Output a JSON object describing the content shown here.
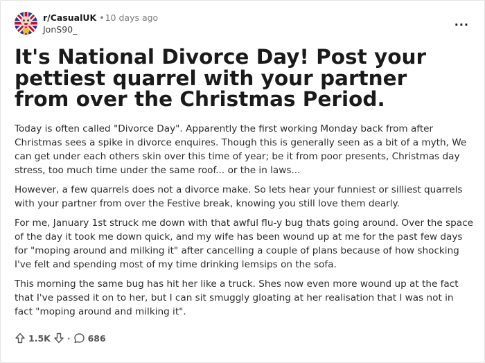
{
  "post": {
    "subreddit": "r/CasualUK",
    "separator": "•",
    "age": "10 days ago",
    "author": "JonS90_",
    "more_label": "...",
    "title": "It's National Divorce Day! Post your pettiest quarrel with your partner from over the Christmas Period.",
    "paragraphs": [
      "Today is often called \"Divorce Day\". Apparently the first working Monday back from after Christmas sees a spike in divorce enquires. Though this is generally seen as a bit of a myth, We can get under each others skin over this time of year; be it from poor presents, Christmas day stress, too much time under the same roof... or the in laws...",
      "However, a few quarrels does not a divorce make. So lets hear your funniest or silliest quarrels with your partner from over the Festive break, knowing you still love them dearly.",
      "For me, January 1st struck me down with that awful flu-y bug thats going around. Over the space of the day it took me down quick, and my wife has been wound up at me for the past few days for \"moping around and milking it\" after cancelling a couple of plans because of how shocking I've felt and spending most of my time drinking lemsips on the sofa.",
      "This morning the same bug has hit her like a truck. Shes now even more wound up at the fact that I've passed it on to her, but I can sit smuggly gloating at her realisation that I was not in fact \"moping around and milking it\"."
    ]
  },
  "actions": {
    "upvotes": "1.5K",
    "separator": "·",
    "comments": "686"
  },
  "icons": {
    "avatar": "subreddit-avatar-icon",
    "more": "more-options-icon",
    "upvote": "upvote-arrow-icon",
    "downvote": "downvote-arrow-icon",
    "comment": "comment-bubble-icon"
  },
  "colors": {
    "text": "#1a1a1b",
    "muted": "#7c7c7c",
    "border": "#e4e4e4"
  }
}
